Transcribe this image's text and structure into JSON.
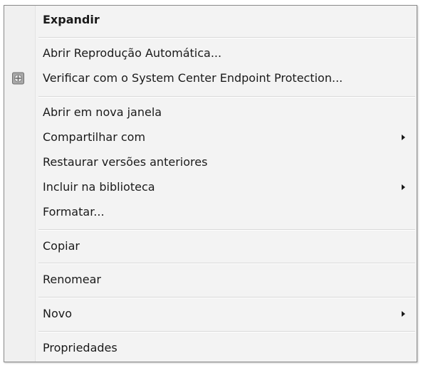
{
  "context_menu": {
    "items": [
      {
        "label": "Expandir"
      },
      {
        "label": "Abrir Reprodução Automática..."
      },
      {
        "label": "Verificar com o System Center Endpoint Protection...",
        "icon": "shield-icon"
      },
      {
        "label": "Abrir em nova janela"
      },
      {
        "label": "Compartilhar com"
      },
      {
        "label": "Restaurar versões anteriores"
      },
      {
        "label": "Incluir na biblioteca"
      },
      {
        "label": "Formatar..."
      },
      {
        "label": "Copiar"
      },
      {
        "label": "Renomear"
      },
      {
        "label": "Novo"
      },
      {
        "label": "Propriedades"
      }
    ]
  }
}
